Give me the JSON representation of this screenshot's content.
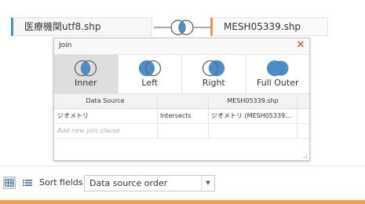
{
  "canvas": {
    "left_table": "医療機関utf8.shp",
    "right_table": "MESH05339.shp",
    "connector_icon": "inner-join-icon"
  },
  "join_dialog": {
    "title": "Join",
    "close_icon": "close-icon",
    "join_types": [
      {
        "label": "Inner",
        "icon": "inner-join-icon",
        "selected": true
      },
      {
        "label": "Left",
        "icon": "left-join-icon",
        "selected": false
      },
      {
        "label": "Right",
        "icon": "right-join-icon",
        "selected": false
      },
      {
        "label": "Full Outer",
        "icon": "full-outer-join-icon",
        "selected": false
      }
    ],
    "clause_headers": {
      "left": "Data Source",
      "operator": "",
      "right": "MESH05339.shp"
    },
    "clauses": [
      {
        "left": "ジオメトリ",
        "operator": "Intersects",
        "right": "ジオメトリ (MESH05339..."
      }
    ],
    "add_clause_placeholder": "Add new join clause"
  },
  "toolbar": {
    "grid_view_icon": "grid-view-icon",
    "list_view_icon": "list-view-icon",
    "sort_label": "Sort fields",
    "sort_value": "Data source order"
  },
  "colors": {
    "join_blue": "#4a8fc9",
    "left_accent": "#4a8fc9",
    "right_accent": "#e8954d",
    "close_red": "#d0422b",
    "bottom_bar": "#f0a14f"
  }
}
